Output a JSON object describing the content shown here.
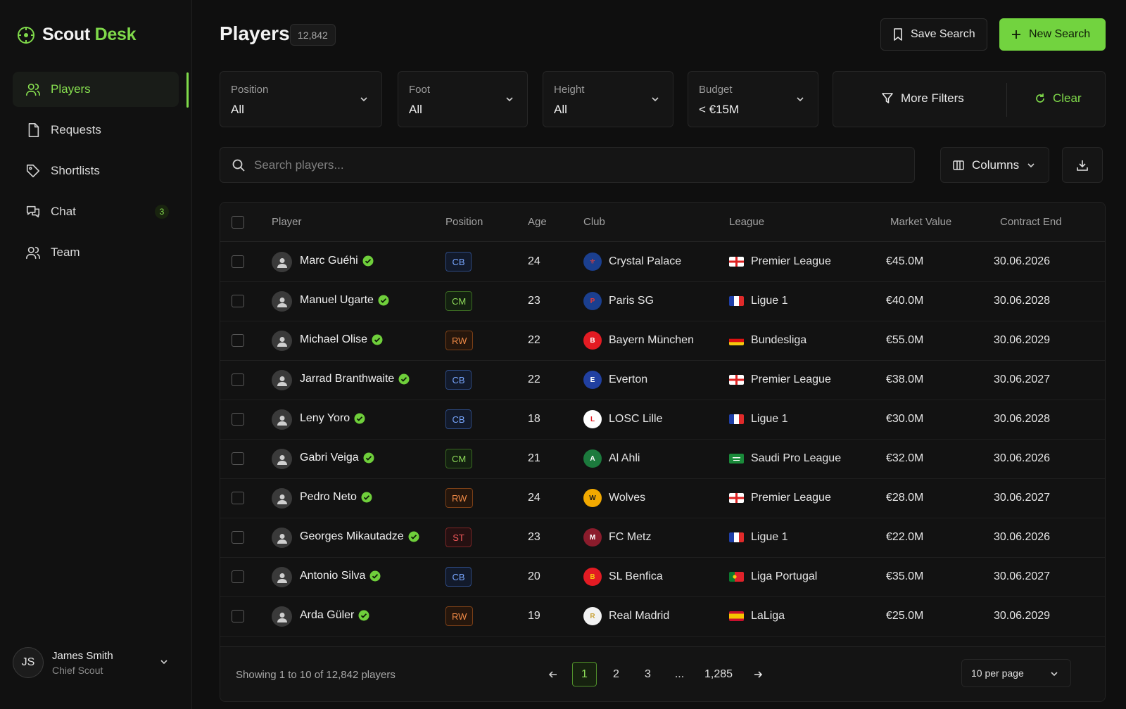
{
  "brand": {
    "name": "Scout",
    "accent": "Desk",
    "icon": "target-icon",
    "accent_color": "#7fd94a"
  },
  "sidebar": {
    "items": [
      {
        "label": "Players",
        "icon": "users-icon",
        "active": true
      },
      {
        "label": "Requests",
        "icon": "file-icon"
      },
      {
        "label": "Shortlists",
        "icon": "tag-icon"
      },
      {
        "label": "Chat",
        "icon": "chat-icon",
        "badge": "3"
      },
      {
        "label": "Team",
        "icon": "team-icon"
      }
    ],
    "profile": {
      "initials": "JS",
      "name": "James Smith",
      "role": "Chief Scout"
    }
  },
  "header": {
    "title": "Players",
    "count": "12,842",
    "save_label": "Save Search",
    "new_label": "New Search"
  },
  "filters": [
    {
      "label": "Position",
      "value": "All"
    },
    {
      "label": "Foot",
      "value": "All"
    },
    {
      "label": "Height",
      "value": "All"
    },
    {
      "label": "Budget",
      "value": "< €15M"
    }
  ],
  "more_filters_label": "More Filters",
  "clear_label": "Clear",
  "search": {
    "placeholder": "Search players..."
  },
  "columns_label": "Columns",
  "table": {
    "headers": {
      "player": "Player",
      "position": "Position",
      "age": "Age",
      "club": "Club",
      "league": "League",
      "value": "Market Value",
      "contract": "Contract End"
    },
    "rows": [
      {
        "name": "Marc Guéhi",
        "pos": "CB",
        "age": "24",
        "club": "Crystal Palace",
        "league": "Premier League",
        "flag": "eng",
        "value": "€45.0M",
        "contract": "30.06.2026"
      },
      {
        "name": "Manuel Ugarte",
        "pos": "CM",
        "age": "23",
        "club": "Paris SG",
        "league": "Ligue 1",
        "flag": "fra",
        "value": "€40.0M",
        "contract": "30.06.2028"
      },
      {
        "name": "Michael Olise",
        "pos": "RW",
        "age": "22",
        "club": "Bayern München",
        "league": "Bundesliga",
        "flag": "ger",
        "value": "€55.0M",
        "contract": "30.06.2029"
      },
      {
        "name": "Jarrad Branthwaite",
        "pos": "CB",
        "age": "22",
        "club": "Everton",
        "league": "Premier League",
        "flag": "eng",
        "value": "€38.0M",
        "contract": "30.06.2027"
      },
      {
        "name": "Leny Yoro",
        "pos": "CB",
        "age": "18",
        "club": "LOSC Lille",
        "league": "Ligue 1",
        "flag": "fra",
        "value": "€30.0M",
        "contract": "30.06.2028"
      },
      {
        "name": "Gabri Veiga",
        "pos": "CM",
        "age": "21",
        "club": "Al Ahli",
        "league": "Saudi Pro League",
        "flag": "ksa",
        "value": "€32.0M",
        "contract": "30.06.2026"
      },
      {
        "name": "Pedro Neto",
        "pos": "RW",
        "age": "24",
        "club": "Wolves",
        "league": "Premier League",
        "flag": "eng",
        "value": "€28.0M",
        "contract": "30.06.2027"
      },
      {
        "name": "Georges Mikautadze",
        "pos": "ST",
        "age": "23",
        "club": "FC Metz",
        "league": "Ligue 1",
        "flag": "fra",
        "value": "€22.0M",
        "contract": "30.06.2026"
      },
      {
        "name": "Antonio Silva",
        "pos": "CB",
        "age": "20",
        "club": "SL Benfica",
        "league": "Liga Portugal",
        "flag": "por",
        "value": "€35.0M",
        "contract": "30.06.2027"
      },
      {
        "name": "Arda Güler",
        "pos": "RW",
        "age": "19",
        "club": "Real Madrid",
        "league": "LaLiga",
        "flag": "esp",
        "value": "€25.0M",
        "contract": "30.06.2029"
      }
    ]
  },
  "footer": {
    "showing": "Showing 1 to 10 of 12,842 players",
    "pages": [
      "1",
      "2",
      "3",
      "...",
      "1,285"
    ],
    "current_page": "1",
    "per_page": "10 per page"
  }
}
